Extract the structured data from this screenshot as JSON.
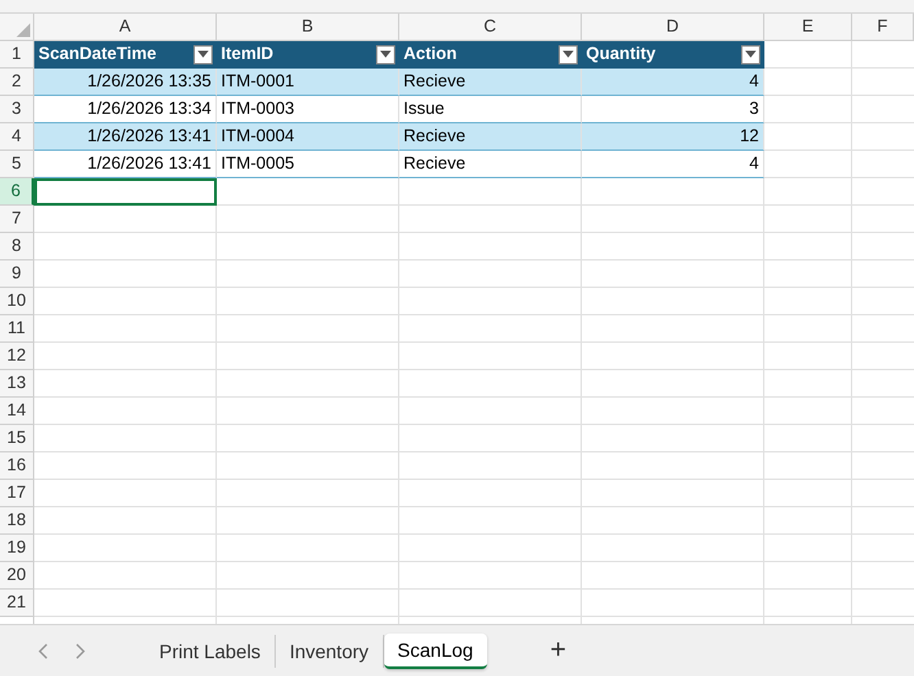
{
  "columns": [
    "A",
    "B",
    "C",
    "D",
    "E",
    "F"
  ],
  "row_headers": [
    {
      "label": "1",
      "selected": false
    },
    {
      "label": "2",
      "selected": false
    },
    {
      "label": "3",
      "selected": false
    },
    {
      "label": "4",
      "selected": false
    },
    {
      "label": "5",
      "selected": false
    },
    {
      "label": "6",
      "selected": true
    },
    {
      "label": "7",
      "selected": false
    },
    {
      "label": "8",
      "selected": false
    },
    {
      "label": "9",
      "selected": false
    },
    {
      "label": "10",
      "selected": false
    },
    {
      "label": "11",
      "selected": false
    },
    {
      "label": "12",
      "selected": false
    },
    {
      "label": "13",
      "selected": false
    },
    {
      "label": "14",
      "selected": false
    },
    {
      "label": "15",
      "selected": false
    },
    {
      "label": "16",
      "selected": false
    },
    {
      "label": "17",
      "selected": false
    },
    {
      "label": "18",
      "selected": false
    },
    {
      "label": "19",
      "selected": false
    },
    {
      "label": "20",
      "selected": false
    },
    {
      "label": "21",
      "selected": false
    }
  ],
  "table": {
    "columns": [
      "ScanDateTime",
      "ItemID",
      "Action",
      "Quantity"
    ],
    "rows": [
      [
        "1/26/2026 13:35",
        "ITM-0001",
        "Recieve",
        "4"
      ],
      [
        "1/26/2026 13:34",
        "ITM-0003",
        "Issue",
        "3"
      ],
      [
        "1/26/2026 13:41",
        "ITM-0004",
        "Recieve",
        "12"
      ],
      [
        "1/26/2026 13:41",
        "ITM-0005",
        "Recieve",
        "4"
      ]
    ]
  },
  "sheet_tabs": [
    {
      "label": "Print Labels",
      "selected": false
    },
    {
      "label": "Inventory",
      "selected": false
    },
    {
      "label": "ScanLog",
      "selected": true
    }
  ],
  "add_sheet": "+"
}
